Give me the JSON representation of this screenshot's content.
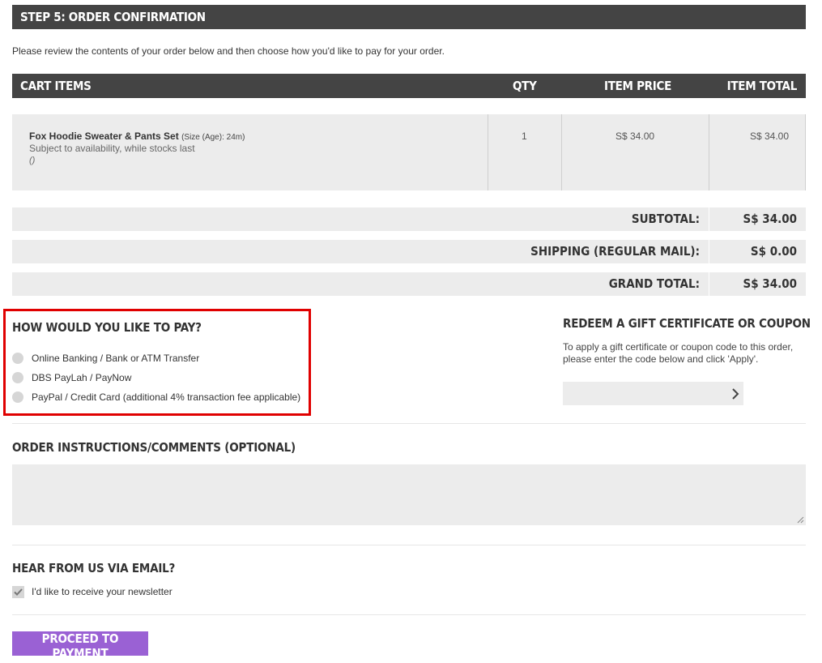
{
  "step_header": "STEP 5: ORDER CONFIRMATION",
  "intro_text": "Please review the contents of your order below and then choose how you'd like to pay for your order.",
  "cart": {
    "headers": {
      "items": "CART ITEMS",
      "qty": "QTY",
      "item_price": "ITEM PRICE",
      "item_total": "ITEM TOTAL"
    },
    "item": {
      "name": "Fox Hoodie Sweater & Pants Set",
      "size": "(Size (Age): 24m)",
      "availability": "Subject to availability, while stocks last",
      "note": "()",
      "qty": "1",
      "price": "S$ 34.00",
      "total": "S$ 34.00"
    }
  },
  "totals": {
    "subtotal_label": "SUBTOTAL:",
    "subtotal_value": "S$ 34.00",
    "shipping_label": "SHIPPING (REGULAR MAIL):",
    "shipping_value": "S$ 0.00",
    "grand_label": "GRAND TOTAL:",
    "grand_value": "S$ 34.00"
  },
  "payment": {
    "title": "HOW WOULD YOU LIKE TO PAY?",
    "options": [
      "Online Banking / Bank or ATM Transfer",
      "DBS PayLah / PayNow",
      "PayPal / Credit Card (additional 4% transaction fee applicable)"
    ]
  },
  "gift": {
    "title": "REDEEM A GIFT CERTIFICATE OR COUPON",
    "description": "To apply a gift certificate or coupon code to this order, please enter the code below and click 'Apply'.",
    "input_value": "",
    "apply_icon": "chevron-right-icon"
  },
  "comments": {
    "title": "ORDER INSTRUCTIONS/COMMENTS (OPTIONAL)",
    "value": ""
  },
  "newsletter": {
    "title": "HEAR FROM US VIA EMAIL?",
    "label": "I'd like to receive your newsletter",
    "checked": true
  },
  "proceed_label": "PROCEED TO PAYMENT",
  "colors": {
    "header_bg": "#444444",
    "row_bg": "#ececec",
    "accent_purple": "#9a61d4",
    "highlight_red": "#e00000"
  }
}
